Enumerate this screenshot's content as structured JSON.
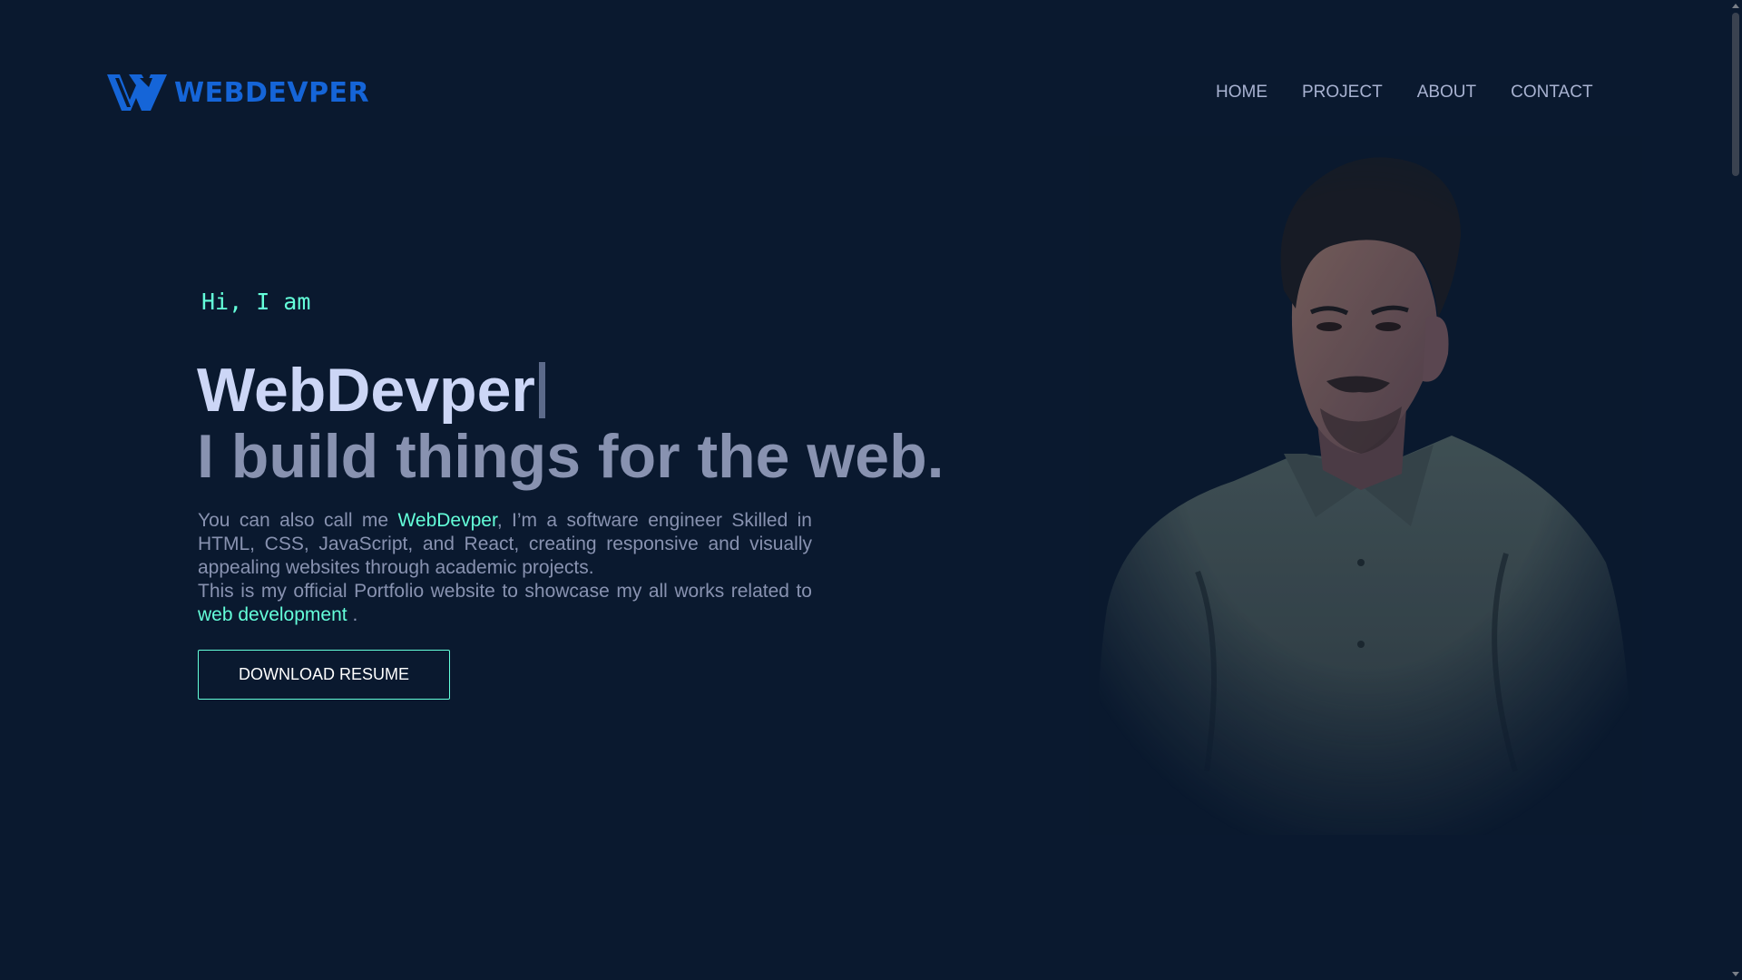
{
  "header": {
    "logo_text": "WEBDEVPER",
    "nav": [
      {
        "label": "HOME"
      },
      {
        "label": "PROJECT"
      },
      {
        "label": "ABOUT"
      },
      {
        "label": "CONTACT"
      }
    ]
  },
  "hero": {
    "greeting": "Hi, I am",
    "name": "WebDevper",
    "tagline": "I build things for the web.",
    "bio": {
      "part1": "You can also call me ",
      "highlight1": "WebDevper",
      "part2": ", I’m a software engineer Skilled in HTML, CSS, JavaScript, and React, creating responsive and visually appealing websites through academic projects.",
      "part3": "This is my official Portfolio website to showcase my all works related to ",
      "highlight2": "web development",
      "part4": " ."
    },
    "resume_button": "DOWNLOAD RESUME"
  },
  "colors": {
    "background": "#0a192f",
    "accent": "#64ffda",
    "brand_blue": "#1565d8",
    "heading": "#ccd6f6",
    "text": "#8892b0"
  },
  "icons": {
    "logo": "w-logo-icon",
    "portrait": "portrait-photo"
  }
}
